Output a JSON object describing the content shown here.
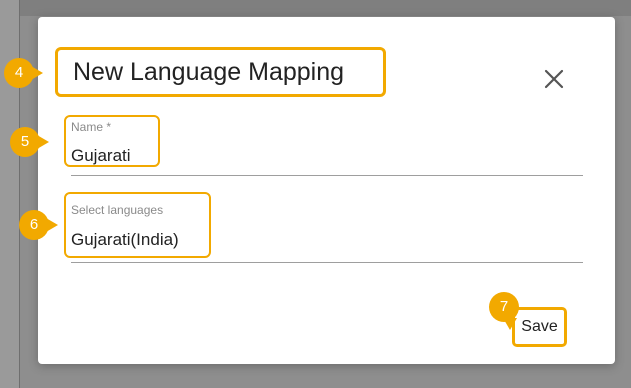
{
  "dialog": {
    "title": "New Language Mapping",
    "close_icon": "close-icon",
    "name_field": {
      "label": "Name *",
      "value": "Gujarati"
    },
    "languages_field": {
      "label": "Select languages",
      "value": "Gujarati(India)"
    },
    "save_label": "Save"
  },
  "callouts": [
    "4",
    "5",
    "6",
    "7"
  ],
  "colors": {
    "highlight": "#f2a900",
    "backdrop": "#8e8e8e",
    "dialog_bg": "#ffffff"
  }
}
